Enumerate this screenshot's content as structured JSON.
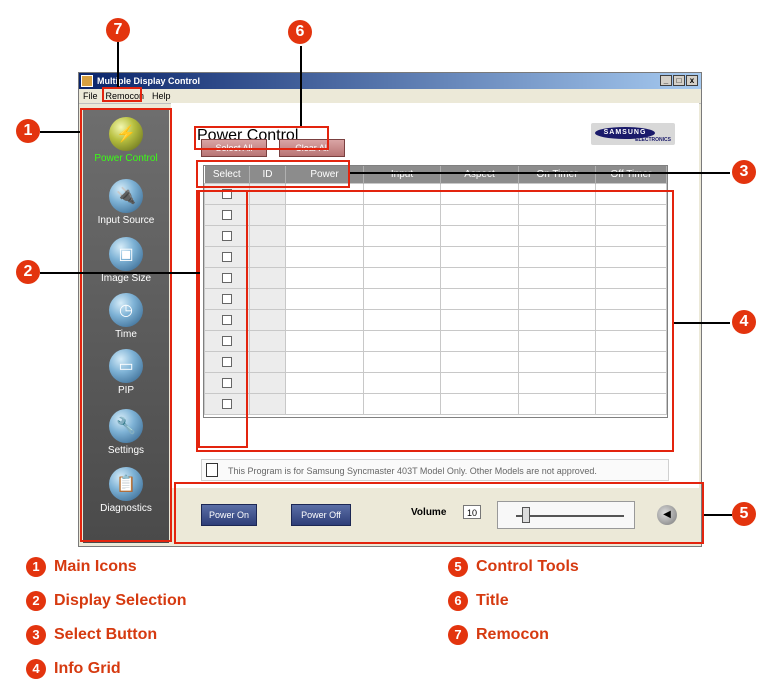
{
  "window": {
    "title": "Multiple Display Control",
    "controls": [
      "_",
      "□",
      "x"
    ]
  },
  "menu": [
    "File",
    "Remocon",
    "Help"
  ],
  "sidebar": {
    "items": [
      {
        "label": "Power Control",
        "icon": "power-plug-icon",
        "active": true
      },
      {
        "label": "Input Source",
        "icon": "input-plug-icon"
      },
      {
        "label": "Image Size",
        "icon": "image-size-icon"
      },
      {
        "label": "Time",
        "icon": "clock-icon"
      },
      {
        "label": "PIP",
        "icon": "pip-monitor-icon"
      },
      {
        "label": "Settings",
        "icon": "settings-wrench-icon"
      },
      {
        "label": "Diagnostics",
        "icon": "diagnostics-clipboard-icon"
      }
    ]
  },
  "main": {
    "title": "Power Control",
    "brand": {
      "name": "SAMSUNG",
      "sub": "ELECTRONICS"
    },
    "select_all": "Select All",
    "clear_all": "Clear All",
    "grid": {
      "columns": [
        "Select",
        "ID",
        "Power",
        "Input",
        "Aspect",
        "On Timer",
        "Off Timer"
      ],
      "row_count": 11
    },
    "notice": "This Program is for Samsung Syncmaster 403T Model Only. Other Models are not approved."
  },
  "controls": {
    "power_on": "Power On",
    "power_off": "Power Off",
    "volume_label": "Volume",
    "volume_value": "10",
    "volume_level_fraction": 0.1
  },
  "callouts": [
    "1",
    "2",
    "3",
    "4",
    "5",
    "6",
    "7"
  ],
  "legend": [
    {
      "num": "1",
      "label": "Main Icons"
    },
    {
      "num": "2",
      "label": "Display Selection"
    },
    {
      "num": "3",
      "label": "Select Button"
    },
    {
      "num": "4",
      "label": "Info Grid"
    },
    {
      "num": "5",
      "label": "Control Tools"
    },
    {
      "num": "6",
      "label": "Title"
    },
    {
      "num": "7",
      "label": "Remocon"
    }
  ],
  "colors": {
    "callout": "#e3340e",
    "legend_text": "#d63a10",
    "active_nav": "#39ff14"
  }
}
